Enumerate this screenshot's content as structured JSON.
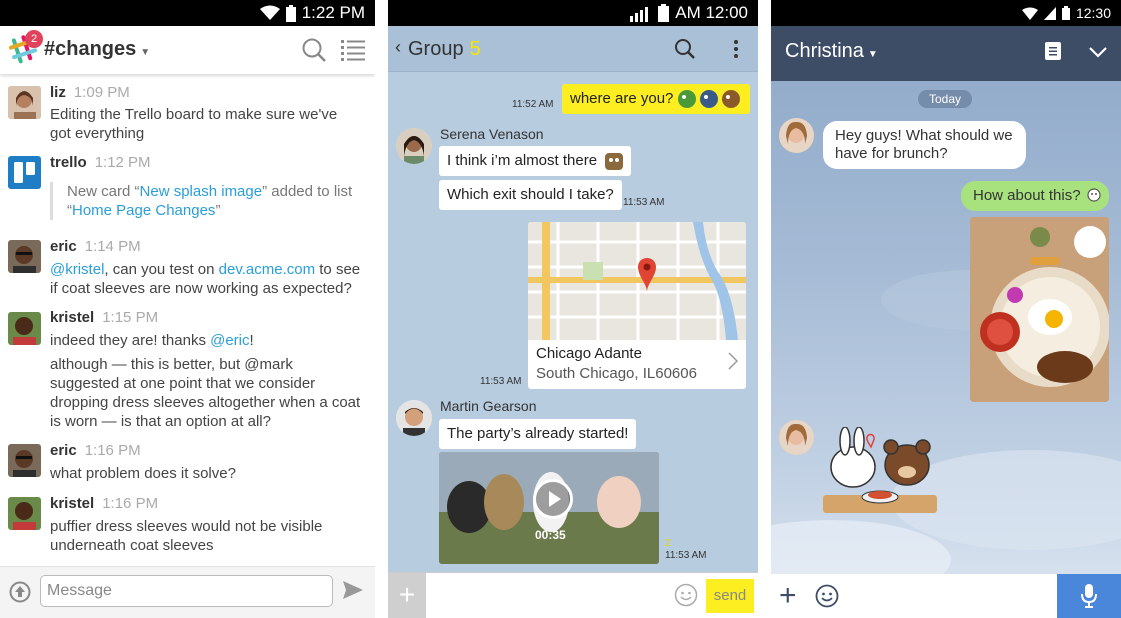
{
  "slack": {
    "status_time": "1:22 PM",
    "channel": "#changes",
    "notification_count": "2",
    "messages": [
      {
        "name": "liz",
        "time": "1:09 PM",
        "text": "Editing the Trello board to make sure we've got everything"
      },
      {
        "name": "trello",
        "time": "1:12 PM",
        "card_prefix": "New card “",
        "card_link": "New splash image",
        "card_mid": "” added to list “",
        "list_link": "Home Page Changes",
        "card_suffix": "”"
      },
      {
        "name": "eric",
        "time": "1:14 PM",
        "mention": "@kristel",
        "text_a": ", can you test on ",
        "link": "dev.acme.com",
        "text_b": " to see if coat sleeves are now working as expected?"
      },
      {
        "name": "kristel",
        "time": "1:15 PM",
        "text_a": "indeed they are! thanks ",
        "mention": "@eric",
        "text_b": "!",
        "text_2": "although — this is better, but @mark suggested at one point that we consider dropping dress sleeves altogether when a coat is worn — is that an option at all?"
      },
      {
        "name": "eric",
        "time": "1:16 PM",
        "text": "what problem does it solve?"
      },
      {
        "name": "kristel",
        "time": "1:16 PM",
        "text": "puffier dress sleeves would not be visible underneath coat sleeves"
      }
    ],
    "input_placeholder": "Message"
  },
  "kakao": {
    "status_time": "AM 12:00",
    "title": "Group",
    "member_count": "5",
    "my_message": "where are you?",
    "my_time": "11:52 AM",
    "serena": {
      "name": "Serena Venason",
      "msg1": "I think i’m almost there",
      "msg2": "Which exit should I take?",
      "time": "11:53 AM"
    },
    "map": {
      "place": "Chicago Adante",
      "address": "South Chicago, IL60606",
      "time": "11:53 AM"
    },
    "martin": {
      "name": "Martin Gearson",
      "msg": "The party’s already started!",
      "video_duration": "00:35",
      "unread": "2",
      "time": "11:53 AM"
    },
    "send_label": "send"
  },
  "line": {
    "status_time": "12:30",
    "contact": "Christina",
    "day_label": "Today",
    "incoming": "Hey guys! What should we have for brunch?",
    "outgoing": "How about this?"
  },
  "colors": {
    "slack_link": "#2a9ed8",
    "kakao_yellow": "#fcee21",
    "line_header": "#3e4d66",
    "line_green": "#a8e27e",
    "line_mic": "#4a86d9"
  }
}
